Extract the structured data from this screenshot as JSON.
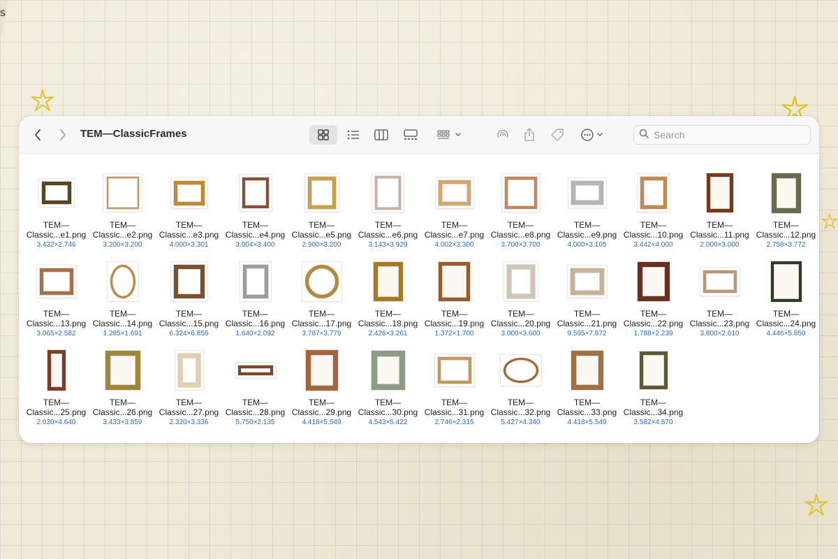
{
  "corner_text": "s",
  "window": {
    "title": "TEM—ClassicFrames",
    "search_placeholder": "Search"
  },
  "toolbar_icons": [
    "back-icon",
    "forward-icon",
    "icon-view-icon",
    "list-view-icon",
    "column-view-icon",
    "gallery-view-icon",
    "group-icon",
    "airdrop-icon",
    "share-icon",
    "tag-icon",
    "more-icon",
    "search-icon"
  ],
  "files": [
    {
      "name1": "TEM—",
      "name2": "Classic...e1.png",
      "dims": "3.432×2.746",
      "w": 50,
      "h": 40,
      "color": "#5a4320",
      "thick": 5,
      "shape": "rect",
      "bg": true
    },
    {
      "name1": "TEM—",
      "name2": "Classic...e2.png",
      "dims": "3.200×3.200",
      "w": 54,
      "h": 54,
      "color": "#c99a55",
      "thick": 2,
      "shape": "rect",
      "bg": true
    },
    {
      "name1": "TEM—",
      "name2": "Classic...e3.png",
      "dims": "4.000×3.301",
      "w": 52,
      "h": 43,
      "color": "#c3892f",
      "thick": 5,
      "shape": "rect",
      "bg": true
    },
    {
      "name1": "TEM—",
      "name2": "Classic...e4.png",
      "dims": "3.004×3.400",
      "w": 46,
      "h": 52,
      "color": "#8a4d35",
      "thick": 4,
      "shape": "rect",
      "bg": true
    },
    {
      "name1": "TEM—",
      "name2": "Classic...e5.png",
      "dims": "2.900×3.200",
      "w": 48,
      "h": 54,
      "color": "#c7a047",
      "thick": 5,
      "shape": "rect",
      "bg": true
    },
    {
      "name1": "TEM—",
      "name2": "Classic...e6.png",
      "dims": "3.143×3.929",
      "w": 45,
      "h": 56,
      "color": "#ccb19a",
      "thick": 3,
      "shape": "rect",
      "bg": true
    },
    {
      "name1": "TEM—",
      "name2": "Classic...e7.png",
      "dims": "4.002×3.300",
      "w": 54,
      "h": 44,
      "color": "#d2a66d",
      "thick": 5,
      "shape": "rect",
      "bg": true
    },
    {
      "name1": "TEM—",
      "name2": "Classic...e8.png",
      "dims": "3.700×3.700",
      "w": 54,
      "h": 54,
      "color": "#c6855a",
      "thick": 4,
      "shape": "rect",
      "bg": true
    },
    {
      "name1": "TEM—",
      "name2": "Classic...e9.png",
      "dims": "4.000×3.105",
      "w": 54,
      "h": 42,
      "color": "#b9b4b4",
      "thick": 6,
      "shape": "rect",
      "bg": true
    },
    {
      "name1": "TEM—",
      "name2": "Classic...10.png",
      "dims": "3.442×4.000",
      "w": 46,
      "h": 54,
      "color": "#c18a52",
      "thick": 5,
      "shape": "rect",
      "bg": true
    },
    {
      "name1": "TEM—",
      "name2": "Classic...11.png",
      "dims": "2.000×3.000",
      "w": 38,
      "h": 56,
      "color": "#7a3818",
      "thick": 5,
      "shape": "rect",
      "bg": false
    },
    {
      "name1": "TEM—",
      "name2": "Classic...12.png",
      "dims": "2.758×3.772",
      "w": 42,
      "h": 57,
      "color": "#6c6a4d",
      "thick": 7,
      "shape": "rect",
      "bg": false
    },
    {
      "name1": "TEM—",
      "name2": "Classic...13.png",
      "dims": "3.065×2.582",
      "w": 56,
      "h": 46,
      "color": "#a87046",
      "thick": 5,
      "shape": "rect",
      "bg": true
    },
    {
      "name1": "TEM—",
      "name2": "Classic...14.png",
      "dims": "1.285×1.691",
      "w": 44,
      "h": 56,
      "color": "#b88a3c",
      "thick": 3,
      "shape": "oval",
      "bg": true
    },
    {
      "name1": "TEM—",
      "name2": "Classic...15.png",
      "dims": "6.324×6.856",
      "w": 52,
      "h": 56,
      "color": "#7a5030",
      "thick": 6,
      "shape": "rect",
      "bg": true
    },
    {
      "name1": "TEM—",
      "name2": "Classic...16.png",
      "dims": "1.640×2.092",
      "w": 44,
      "h": 56,
      "color": "#9c9c9c",
      "thick": 5,
      "shape": "rect",
      "bg": true
    },
    {
      "name1": "TEM—",
      "name2": "Classic...17.png",
      "dims": "3.787×3.779",
      "w": 56,
      "h": 56,
      "color": "#b38a3a",
      "thick": 5,
      "shape": "oval",
      "bg": true
    },
    {
      "name1": "TEM—",
      "name2": "Classic...18.png",
      "dims": "2.426×3.261",
      "w": 42,
      "h": 56,
      "color": "#a67a23",
      "thick": 6,
      "shape": "rect",
      "bg": false
    },
    {
      "name1": "TEM—",
      "name2": "Classic...19.png",
      "dims": "1.372×1.700",
      "w": 45,
      "h": 56,
      "color": "#9a5a2a",
      "thick": 5,
      "shape": "rect",
      "bg": false
    },
    {
      "name1": "TEM—",
      "name2": "Classic...20.png",
      "dims": "3.000×3.600",
      "w": 48,
      "h": 56,
      "color": "#cfc6b7",
      "thick": 6,
      "shape": "rect",
      "bg": true
    },
    {
      "name1": "TEM—",
      "name2": "Classic...21.png",
      "dims": "9.595×7.872",
      "w": 56,
      "h": 46,
      "color": "#c8b399",
      "thick": 6,
      "shape": "rect",
      "bg": true
    },
    {
      "name1": "TEM—",
      "name2": "Classic...22.png",
      "dims": "1.788×2.239",
      "w": 46,
      "h": 56,
      "color": "#6a2f1e",
      "thick": 7,
      "shape": "rect",
      "bg": false
    },
    {
      "name1": "TEM—",
      "name2": "Classic...23.png",
      "dims": "3.800×2.610",
      "w": 56,
      "h": 40,
      "color": "#b89970",
      "thick": 4,
      "shape": "rect",
      "bg": true
    },
    {
      "name1": "TEM—",
      "name2": "Classic...24.png",
      "dims": "4.446×5.850",
      "w": 44,
      "h": 58,
      "color": "#2d3b22",
      "thick": 4,
      "shape": "rect",
      "bg": false
    },
    {
      "name1": "TEM—",
      "name2": "Classic...25.png",
      "dims": "2.030×4.640",
      "w": 26,
      "h": 58,
      "color": "#7a3f24",
      "thick": 5,
      "shape": "rect",
      "bg": false
    },
    {
      "name1": "TEM—",
      "name2": "Classic...26.png",
      "dims": "3.433×3.859",
      "w": 50,
      "h": 56,
      "color": "#9c8838",
      "thick": 7,
      "shape": "rect",
      "bg": false
    },
    {
      "name1": "TEM—",
      "name2": "Classic...27.png",
      "dims": "2.320×3.336",
      "w": 40,
      "h": 56,
      "color": "#e3cfae",
      "thick": 6,
      "shape": "rect",
      "bg": true
    },
    {
      "name1": "TEM—",
      "name2": "Classic...28.png",
      "dims": "5.750×2.135",
      "w": 58,
      "h": 22,
      "color": "#7b4a2c",
      "thick": 4,
      "shape": "rect",
      "bg": true
    },
    {
      "name1": "TEM—",
      "name2": "Classic...29.png",
      "dims": "4.418×5.549",
      "w": 46,
      "h": 58,
      "color": "#a6643a",
      "thick": 7,
      "shape": "rect",
      "bg": false
    },
    {
      "name1": "TEM—",
      "name2": "Classic...30.png",
      "dims": "4.543×5.422",
      "w": 48,
      "h": 56,
      "color": "#8f9c85",
      "thick": 8,
      "shape": "rect",
      "bg": false
    },
    {
      "name1": "TEM—",
      "name2": "Classic...31.png",
      "dims": "2.746×2.315",
      "w": 56,
      "h": 46,
      "color": "#c19a5a",
      "thick": 4,
      "shape": "rect",
      "bg": true
    },
    {
      "name1": "TEM—",
      "name2": "Classic...32.png",
      "dims": "5.427×4.340",
      "w": 58,
      "h": 44,
      "color": "#9a6a2e",
      "thick": 3,
      "shape": "oval",
      "bg": true
    },
    {
      "name1": "TEM—",
      "name2": "Classic...33.png",
      "dims": "4.418×5.549",
      "w": 46,
      "h": 56,
      "color": "#a07040",
      "thick": 7,
      "shape": "rect",
      "bg": false
    },
    {
      "name1": "TEM—",
      "name2": "Classic...34.png",
      "dims": "3.582×4.870",
      "w": 40,
      "h": 54,
      "color": "#5f5838",
      "thick": 5,
      "shape": "rect",
      "bg": false
    }
  ]
}
